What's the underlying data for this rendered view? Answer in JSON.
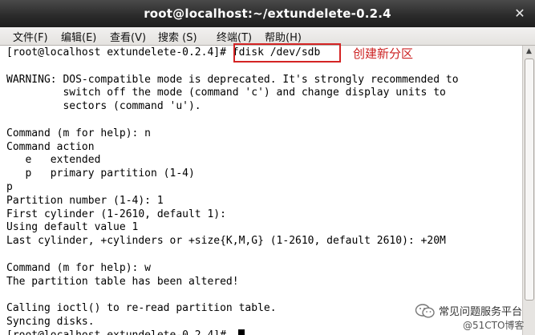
{
  "window": {
    "title": "root@localhost:~/extundelete-0.2.4",
    "close_glyph": "✕"
  },
  "menu": [
    {
      "label": "文件(F)"
    },
    {
      "label": "编辑(E)"
    },
    {
      "label": "查看(V)"
    },
    {
      "label": "搜索 (S)"
    },
    {
      "label": "终端(T)"
    },
    {
      "label": "帮助(H)"
    }
  ],
  "terminal": {
    "lines": [
      "[root@localhost extundelete-0.2.4]# fdisk /dev/sdb",
      "",
      "WARNING: DOS-compatible mode is deprecated. It's strongly recommended to",
      "         switch off the mode (command 'c') and change display units to",
      "         sectors (command 'u').",
      "",
      "Command (m for help): n",
      "Command action",
      "   e   extended",
      "   p   primary partition (1-4)",
      "p",
      "Partition number (1-4): 1",
      "First cylinder (1-2610, default 1):",
      "Using default value 1",
      "Last cylinder, +cylinders or +size{K,M,G} (1-2610, default 2610): +20M",
      "",
      "Command (m for help): w",
      "The partition table has been altered!",
      "",
      "Calling ioctl() to re-read partition table.",
      "Syncing disks.",
      "[root@localhost extundelete-0.2.4]# "
    ]
  },
  "annotation": {
    "text": "创建新分区",
    "color": "#cc2222"
  },
  "watermark": {
    "line1": "常见问题服务平台",
    "line2": "@51CTO博客"
  },
  "colors": {
    "titlebar": "#2a2a2a",
    "terminal_bg": "#ffffff",
    "highlight": "#d42424"
  }
}
